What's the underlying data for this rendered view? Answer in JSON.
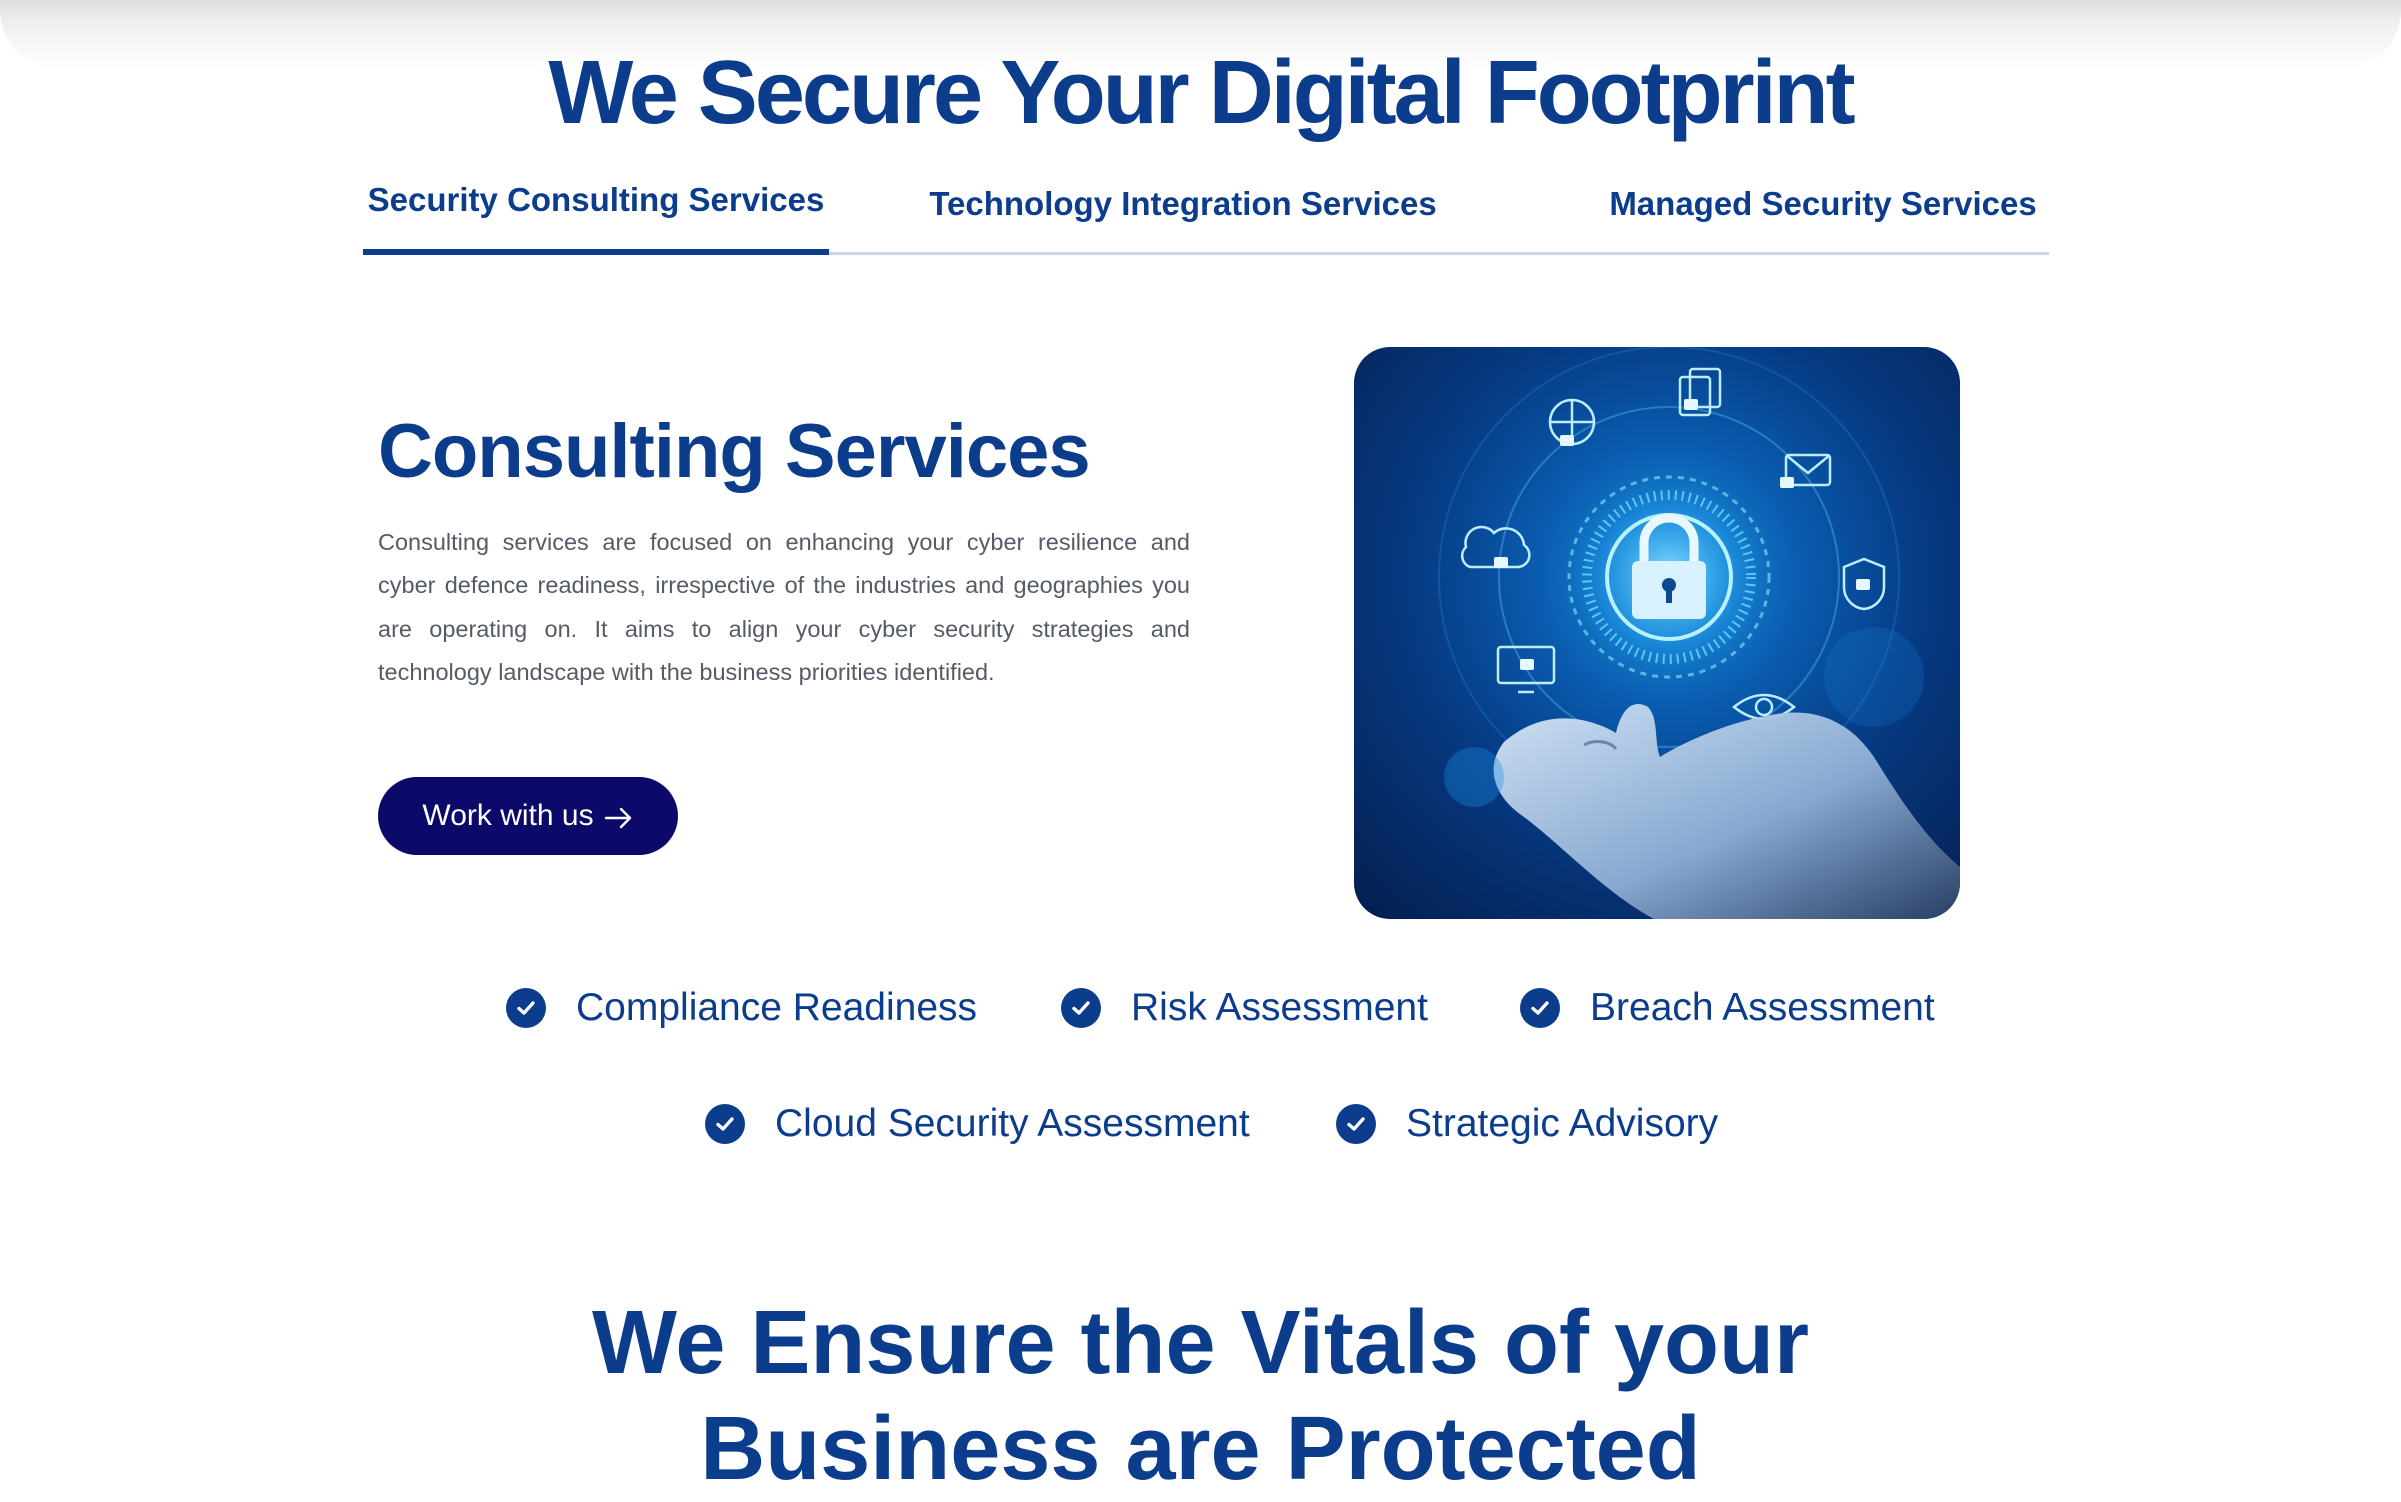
{
  "page": {
    "title": "We Secure Your Digital Footprint"
  },
  "tabs": [
    {
      "label": "Security Consulting Services",
      "active": true
    },
    {
      "label": "Technology Integration Services",
      "active": false
    },
    {
      "label": "Managed Security Services",
      "active": false
    }
  ],
  "section": {
    "heading": "Consulting Services",
    "body": "Consulting services are focused on enhancing your cyber resilience and cyber defence readiness, irrespective of the industries and geographies you are operating on. It aims to align your cyber security strategies and technology landscape with the business priorities identified.",
    "cta_label": "Work with us",
    "cta_icon": "arrow-right-icon"
  },
  "features": [
    {
      "label": "Compliance Readiness",
      "icon": "check-circle-icon"
    },
    {
      "label": "Risk Assessment",
      "icon": "check-circle-icon"
    },
    {
      "label": "Breach Assessment",
      "icon": "check-circle-icon"
    },
    {
      "label": "Cloud Security Assessment",
      "icon": "check-circle-icon"
    },
    {
      "label": "Strategic Advisory",
      "icon": "check-circle-icon"
    }
  ],
  "bottom": {
    "heading_line1": "We Ensure the Vitals of your",
    "heading_line2": "Business are Protected"
  },
  "colors": {
    "brand_blue": "#0c3c8c",
    "button_navy": "#0b0a6b",
    "body_text": "#555b66",
    "tab_underline": "#cdd3e6"
  }
}
